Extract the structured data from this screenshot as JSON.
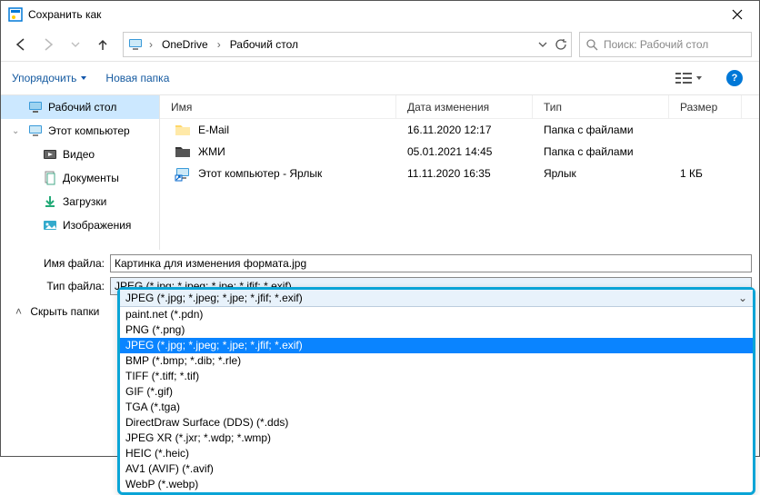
{
  "window": {
    "title": "Сохранить как"
  },
  "nav": {
    "crumbs": [
      "OneDrive",
      "Рабочий стол"
    ],
    "search_placeholder": "Поиск: Рабочий стол"
  },
  "toolbar": {
    "organize": "Упорядочить",
    "new_folder": "Новая папка"
  },
  "sidebar": {
    "items": [
      {
        "label": "Рабочий стол",
        "icon": "desktop",
        "selected": true
      },
      {
        "label": "Этот компьютер",
        "icon": "pc"
      },
      {
        "label": "Видео",
        "icon": "video"
      },
      {
        "label": "Документы",
        "icon": "docs"
      },
      {
        "label": "Загрузки",
        "icon": "downloads"
      },
      {
        "label": "Изображения",
        "icon": "images"
      }
    ]
  },
  "columns": {
    "name": "Имя",
    "date": "Дата изменения",
    "type": "Тип",
    "size": "Размер"
  },
  "files": [
    {
      "name": "E-Mail",
      "date": "16.11.2020 12:17",
      "type": "Папка с файлами",
      "size": ""
    },
    {
      "name": "ЖМИ",
      "date": "05.01.2021 14:45",
      "type": "Папка с файлами",
      "size": ""
    },
    {
      "name": "Этот компьютер - Ярлык",
      "date": "11.11.2020 16:35",
      "type": "Ярлык",
      "size": "1 КБ"
    }
  ],
  "fields": {
    "filename_label": "Имя файла:",
    "filename_value": "Картинка для изменения формата.jpg",
    "filetype_label": "Тип файла:",
    "filetype_value": "JPEG (*.jpg; *.jpeg; *.jpe; *.jfif; *.exif)"
  },
  "hide_folders": "Скрыть папки",
  "dropdown": {
    "selected_index": 2,
    "options": [
      "paint.net (*.pdn)",
      "PNG (*.png)",
      "JPEG (*.jpg; *.jpeg; *.jpe; *.jfif; *.exif)",
      "BMP (*.bmp; *.dib; *.rle)",
      "TIFF (*.tiff; *.tif)",
      "GIF (*.gif)",
      "TGA (*.tga)",
      "DirectDraw Surface (DDS) (*.dds)",
      "JPEG XR (*.jxr; *.wdp; *.wmp)",
      "HEIC (*.heic)",
      "AV1 (AVIF) (*.avif)",
      "WebP (*.webp)"
    ]
  }
}
